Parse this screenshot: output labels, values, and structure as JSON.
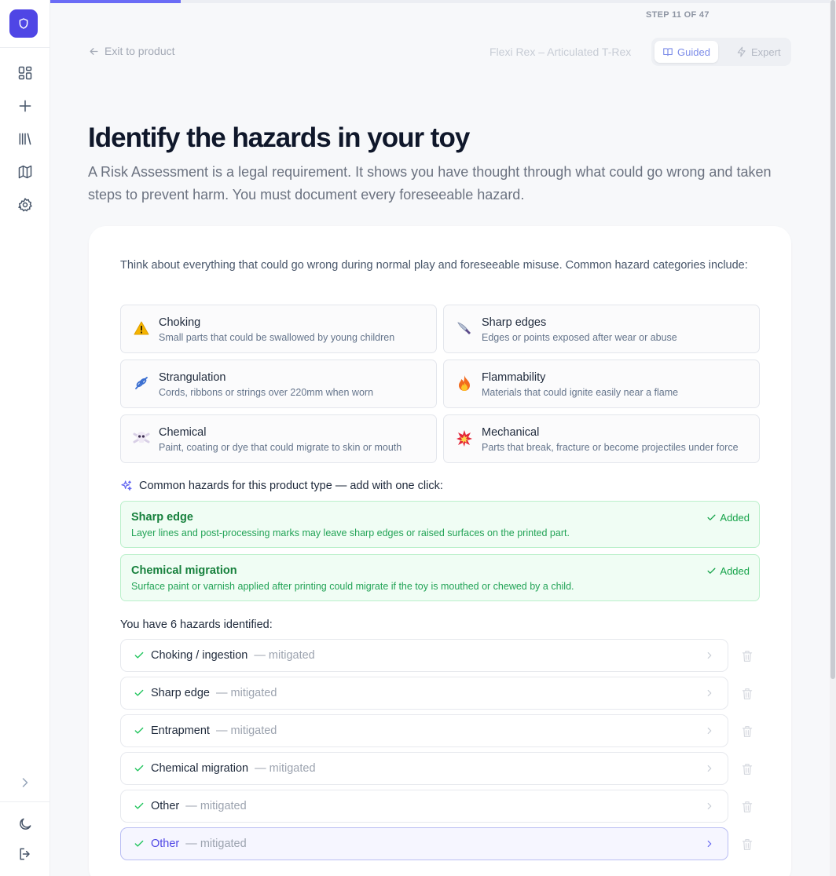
{
  "progress": {
    "fraction": 0.218
  },
  "step_label": "STEP 11 OF 47",
  "sidebar": {
    "nav_items": [
      {
        "icon": "dashboard-icon"
      },
      {
        "icon": "plus-icon"
      },
      {
        "icon": "library-icon"
      },
      {
        "icon": "map-icon"
      },
      {
        "icon": "gear-icon"
      }
    ],
    "footer_items": [
      {
        "icon": "chevron-right-icon"
      },
      {
        "icon": "moon-icon"
      },
      {
        "icon": "logout-icon"
      }
    ]
  },
  "header": {
    "exit_label": "Exit to product",
    "product_name": "Flexi Rex – Articulated T-Rex",
    "modes": {
      "guided": "Guided",
      "expert": "Expert"
    }
  },
  "page": {
    "title": "Identify the hazards in your toy",
    "intro": "A Risk Assessment is a legal requirement. It shows you have thought through what could go wrong and taken steps to prevent harm. You must document every foreseeable hazard."
  },
  "card": {
    "intro": "Think about everything that could go wrong during normal play and foreseeable misuse. Common hazard categories include:",
    "categories": [
      {
        "title": "Choking",
        "desc": "Small parts that could be swallowed by young children",
        "icon": "warning-icon"
      },
      {
        "title": "Sharp edges",
        "desc": "Edges or points exposed after wear or abuse",
        "icon": "knife-icon"
      },
      {
        "title": "Strangulation",
        "desc": "Cords, ribbons or strings over 220mm when worn",
        "icon": "rope-icon"
      },
      {
        "title": "Flammability",
        "desc": "Materials that could ignite easily near a flame",
        "icon": "fire-icon"
      },
      {
        "title": "Chemical",
        "desc": "Paint, coating or dye that could migrate to skin or mouth",
        "icon": "skull-icon"
      },
      {
        "title": "Mechanical",
        "desc": "Parts that break, fracture or become projectiles under force",
        "icon": "burst-icon"
      }
    ],
    "suggestions_heading": "Common hazards for this product type — add with one click:",
    "suggestions": [
      {
        "title": "Sharp edge",
        "desc": "Layer lines and post-processing marks may leave sharp edges or raised surfaces on the printed part.",
        "status": "Added"
      },
      {
        "title": "Chemical migration",
        "desc": "Surface paint or varnish applied after printing could migrate if the toy is mouthed or chewed by a child.",
        "status": "Added"
      }
    ],
    "count_text": "You have 6 hazards identified:",
    "hazards": [
      {
        "name": "Choking / ingestion",
        "status": "— mitigated"
      },
      {
        "name": "Sharp edge",
        "status": "— mitigated"
      },
      {
        "name": "Entrapment",
        "status": "— mitigated"
      },
      {
        "name": "Chemical migration",
        "status": "— mitigated"
      },
      {
        "name": "Other",
        "status": "— mitigated"
      },
      {
        "name": "Other",
        "status": "— mitigated"
      }
    ]
  },
  "colors": {
    "accent": "#4f46e5",
    "success": "#16a34a",
    "success_bg": "#f0fdf4"
  }
}
